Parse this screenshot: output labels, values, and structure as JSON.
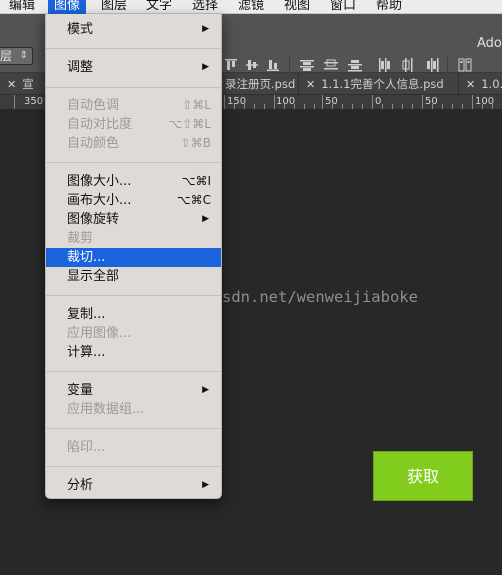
{
  "menubar": {
    "items": [
      "编辑",
      "图像",
      "图层",
      "文字",
      "选择",
      "滤镜",
      "视图",
      "窗口",
      "帮助"
    ],
    "active_index": 1
  },
  "optionsbar": {
    "layer_select_value": "层",
    "app_label": "Ado"
  },
  "tabs": {
    "items": [
      {
        "label": "宣"
      },
      {
        "label": "录注册页.psd"
      },
      {
        "label": "1.1.1完善个人信息.psd"
      },
      {
        "label": "1.0."
      }
    ]
  },
  "ruler": {
    "labels": [
      "350",
      "150",
      "100",
      "50",
      "0",
      "50",
      "100"
    ]
  },
  "image_menu": {
    "items": [
      {
        "label": "模式",
        "shortcut": "",
        "submenu": true,
        "disabled": false
      },
      {
        "label": "调整",
        "shortcut": "",
        "submenu": true,
        "disabled": false
      },
      {
        "label": "自动色调",
        "shortcut": "⇧⌘L",
        "submenu": false,
        "disabled": true
      },
      {
        "label": "自动对比度",
        "shortcut": "⌥⇧⌘L",
        "submenu": false,
        "disabled": true
      },
      {
        "label": "自动颜色",
        "shortcut": "⇧⌘B",
        "submenu": false,
        "disabled": true
      },
      {
        "label": "图像大小...",
        "shortcut": "⌥⌘I",
        "submenu": false,
        "disabled": false
      },
      {
        "label": "画布大小...",
        "shortcut": "⌥⌘C",
        "submenu": false,
        "disabled": false
      },
      {
        "label": "图像旋转",
        "shortcut": "",
        "submenu": true,
        "disabled": false
      },
      {
        "label": "裁剪",
        "shortcut": "",
        "submenu": false,
        "disabled": true
      },
      {
        "label": "裁切...",
        "shortcut": "",
        "submenu": false,
        "disabled": false,
        "highlighted": true
      },
      {
        "label": "显示全部",
        "shortcut": "",
        "submenu": false,
        "disabled": false
      },
      {
        "label": "复制...",
        "shortcut": "",
        "submenu": false,
        "disabled": false
      },
      {
        "label": "应用图像...",
        "shortcut": "",
        "submenu": false,
        "disabled": true
      },
      {
        "label": "计算...",
        "shortcut": "",
        "submenu": false,
        "disabled": false
      },
      {
        "label": "变量",
        "shortcut": "",
        "submenu": true,
        "disabled": false
      },
      {
        "label": "应用数据组...",
        "shortcut": "",
        "submenu": false,
        "disabled": true
      },
      {
        "label": "陷印...",
        "shortcut": "",
        "submenu": false,
        "disabled": true
      },
      {
        "label": "分析",
        "shortcut": "",
        "submenu": true,
        "disabled": false
      }
    ]
  },
  "canvas": {
    "watermark": "sdn.net/wenweijiaboke",
    "button_label": "获取",
    "button_color": "#82cc1e"
  },
  "colors": {
    "menu_highlight": "#1b64dc",
    "menu_bg": "#dedbd6",
    "canvas_bg": "#282828"
  }
}
